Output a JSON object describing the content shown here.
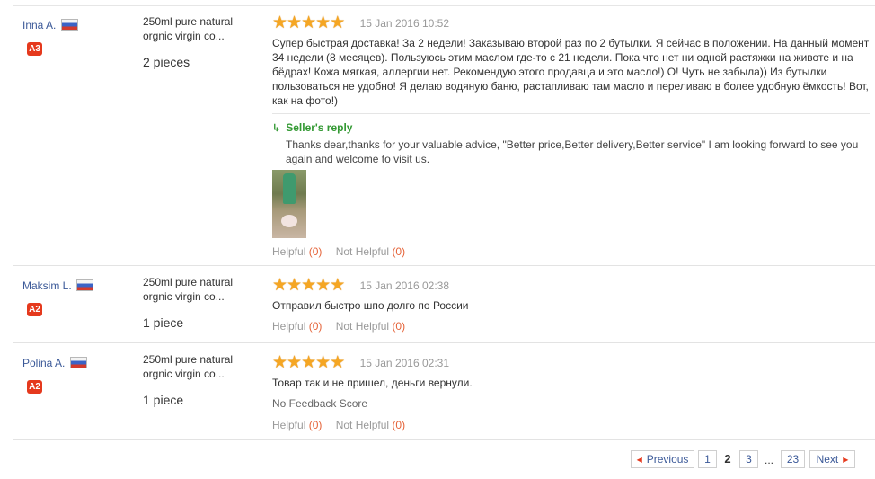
{
  "reviews": [
    {
      "buyer_name": "Inna A.",
      "level": "A3",
      "product_name": "250ml pure natural orgnic virgin co...",
      "quantity": "2 pieces",
      "rating": 5,
      "date": "15 Jan 2016 10:52",
      "text": "Супер быстрая доставка! За 2 недели! Заказываю второй раз по 2 бутылки. Я сейчас в положении. На данный момент 34 недели (8 месяцев). Пользуюсь этим маслом где-то с 21 недели. Пока что нет ни одной растяжки на животе и на бёдрах! Кожа мягкая, аллергии нет. Рекомендую этого продавца и это масло!) О! Чуть не забыла)) Из бутылки пользоваться не удобно! Я делаю водяную баню, растапливаю там масло и переливаю в более удобную ёмкость! Вот, как на фото!)",
      "seller_reply_title": "Seller's reply",
      "seller_reply_text": "Thanks dear,thanks for your valuable advice, \"Better price,Better delivery,Better service\" I am looking forward to see you again and welcome to visit us.",
      "helpful_label": "Helpful",
      "helpful_count": "(0)",
      "not_helpful_label": "Not Helpful",
      "not_helpful_count": "(0)"
    },
    {
      "buyer_name": "Maksim L.",
      "level": "A2",
      "product_name": "250ml pure natural orgnic virgin co...",
      "quantity": "1 piece",
      "rating": 5,
      "date": "15 Jan 2016 02:38",
      "text": "Отправил быстро шпо долго по России",
      "helpful_label": "Helpful",
      "helpful_count": "(0)",
      "not_helpful_label": "Not Helpful",
      "not_helpful_count": "(0)"
    },
    {
      "buyer_name": "Polina A.",
      "level": "A2",
      "product_name": "250ml pure natural orgnic virgin co...",
      "quantity": "1 piece",
      "rating": 5,
      "date": "15 Jan 2016 02:31",
      "text": "Товар так и не пришел, деньги вернули.",
      "no_feedback": "No Feedback Score",
      "helpful_label": "Helpful",
      "helpful_count": "(0)",
      "not_helpful_label": "Not Helpful",
      "not_helpful_count": "(0)"
    }
  ],
  "pagination": {
    "previous": "Previous",
    "next": "Next",
    "pages": [
      "1",
      "2",
      "3",
      "23"
    ],
    "current": "2",
    "ellipsis": "..."
  },
  "colors": {
    "link": "#3b5998",
    "badge": "#e5391d",
    "star": "#f5a623",
    "reply": "#339933",
    "count": "#e5643a"
  },
  "icons": {
    "flag": "russia-flag-icon",
    "star": "star-icon",
    "reply": "reply-arrow-icon",
    "prev": "triangle-left-icon",
    "next": "triangle-right-icon"
  }
}
